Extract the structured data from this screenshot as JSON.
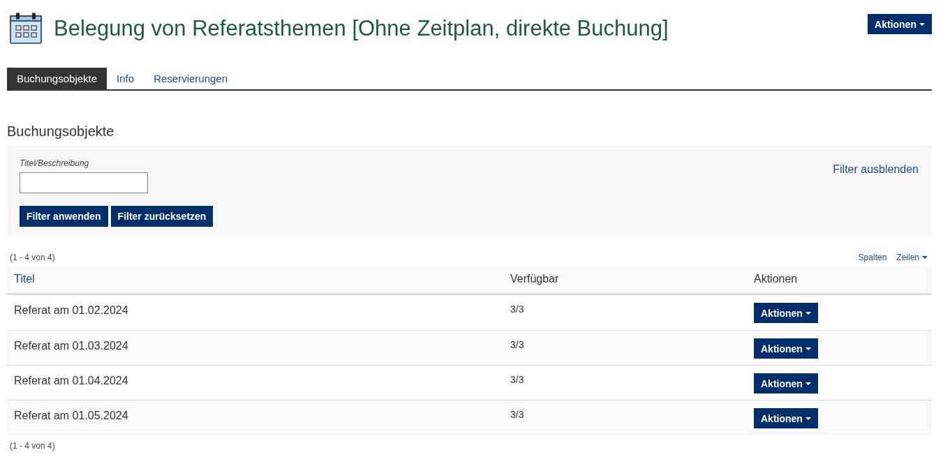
{
  "header": {
    "title": "Belegung von Referatsthemen [Ohne Zeitplan, direkte Buchung]",
    "actions_button": "Aktionen"
  },
  "tabs": [
    {
      "label": "Buchungsobjekte",
      "selected": true
    },
    {
      "label": "Info",
      "selected": false
    },
    {
      "label": "Reservierungen",
      "selected": false
    }
  ],
  "section_title": "Buchungsobjekte",
  "filter": {
    "label": "Titel/Beschreibung",
    "apply_button": "Filter anwenden",
    "reset_button": "Filter zurücksetzen",
    "toggle_link": "Filter ausblenden"
  },
  "table": {
    "count_top": "(1 - 4 von 4)",
    "columns_link": "Spalten",
    "rows_link": "Zeilen",
    "columns": [
      {
        "label": "Titel",
        "kind": "link"
      },
      {
        "label": "Verfügbar",
        "kind": "text"
      },
      {
        "label": "Aktionen",
        "kind": "text"
      }
    ],
    "rows": [
      {
        "title": "Referat am 01.02.2024",
        "available": "3/3",
        "action": "Aktionen"
      },
      {
        "title": "Referat am 01.03.2024",
        "available": "3/3",
        "action": "Aktionen"
      },
      {
        "title": "Referat am 01.04.2024",
        "available": "3/3",
        "action": "Aktionen"
      },
      {
        "title": "Referat am 01.05.2024",
        "available": "3/3",
        "action": "Aktionen"
      }
    ],
    "count_bottom": "(1 - 4 von 4)"
  }
}
